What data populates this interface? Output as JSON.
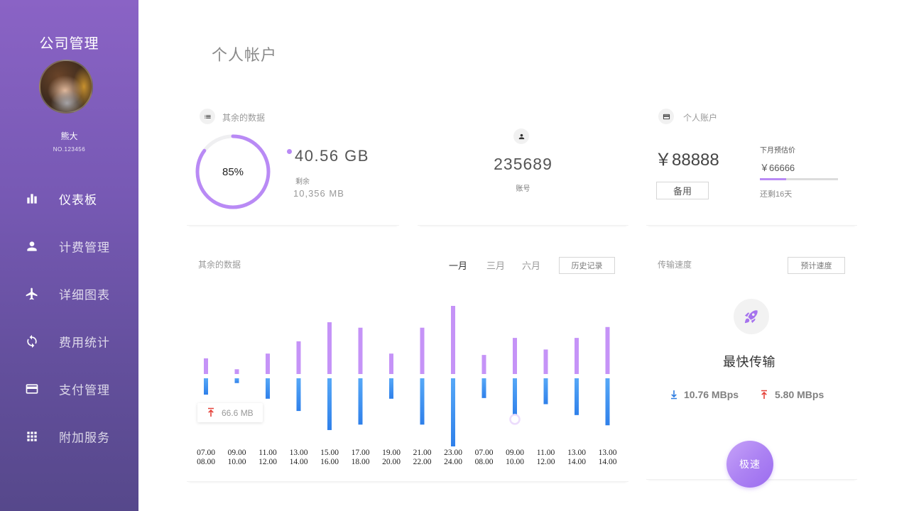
{
  "sidebar": {
    "app_title": "公司管理",
    "user": {
      "name": "熊大",
      "number": "NO.123456"
    },
    "items": [
      {
        "icon": "bar-chart-icon",
        "label": "仪表板",
        "active": true
      },
      {
        "icon": "person-icon",
        "label": "计费管理",
        "active": false
      },
      {
        "icon": "airplane-icon",
        "label": "详细图表",
        "active": false
      },
      {
        "icon": "refresh-icon",
        "label": "费用统计",
        "active": false
      },
      {
        "icon": "credit-card-icon",
        "label": "支付管理",
        "active": false
      },
      {
        "icon": "grid-icon",
        "label": "附加服务",
        "active": false
      }
    ]
  },
  "page_title": "个人帐户",
  "storage_card": {
    "icon": "list-icon",
    "title": "其余的数据",
    "percent": 85,
    "percent_label": "85%",
    "total": "40.56 GB",
    "remaining_label": "剩余",
    "remaining_value": "10,356 MB"
  },
  "account_card": {
    "icon": "person-icon",
    "number": "235689",
    "label": "账号"
  },
  "balance_card": {
    "icon": "credit-card-icon",
    "title": "个人账户",
    "balance": "￥88888",
    "spare_button": "备用",
    "estimate_label": "下月预估价",
    "estimate_value": "￥66666",
    "estimate_progress": 0.34,
    "days_left": "还剩16天"
  },
  "usage_card": {
    "tabs": [
      {
        "label": "一月",
        "active": true
      },
      {
        "label": "三月",
        "active": false
      },
      {
        "label": "六月",
        "active": false
      }
    ],
    "history_button": "历史记录",
    "tooltip": {
      "icon": "upload-arrow-icon",
      "value": "66.6 MB"
    },
    "highlight": {
      "series": 1,
      "index": 10
    }
  },
  "chart_data": {
    "type": "bar",
    "title": "其余的数据",
    "categories": [
      [
        "07.00",
        "08.00"
      ],
      [
        "09.00",
        "10.00"
      ],
      [
        "11.00",
        "12.00"
      ],
      [
        "13.00",
        "14.00"
      ],
      [
        "15.00",
        "16.00"
      ],
      [
        "17.00",
        "18.00"
      ],
      [
        "19.00",
        "20.00"
      ],
      [
        "21.00",
        "22.00"
      ],
      [
        "23.00",
        "24.00"
      ],
      [
        "07.00",
        "08.00"
      ],
      [
        "09.00",
        "10.00"
      ],
      [
        "11.00",
        "12.00"
      ],
      [
        "13.00",
        "14.00"
      ],
      [
        "13.00",
        "14.00"
      ]
    ],
    "series": [
      {
        "color": "#c593f7",
        "values": [
          23,
          7,
          30,
          48,
          76,
          68,
          30,
          68,
          100,
          28,
          53,
          36,
          53,
          69
        ]
      },
      {
        "color": "#2f80ea",
        "values": [
          24,
          7,
          30,
          48,
          76,
          68,
          30,
          68,
          100,
          29,
          54,
          38,
          54,
          69
        ]
      }
    ],
    "grid": false
  },
  "speed_card": {
    "title": "传输速度",
    "estimate_button": "预计速度",
    "icon": "rocket-icon",
    "headline": "最快传输",
    "download": {
      "icon": "download-arrow-icon",
      "value": "10.76 MBps"
    },
    "upload": {
      "icon": "upload-arrow-icon",
      "value": "5.80 MBps"
    },
    "turbo_button": "极速"
  },
  "colors": {
    "accent_purple": "#b98af5",
    "download_blue": "#2f7de0",
    "upload_red": "#e5423a"
  }
}
